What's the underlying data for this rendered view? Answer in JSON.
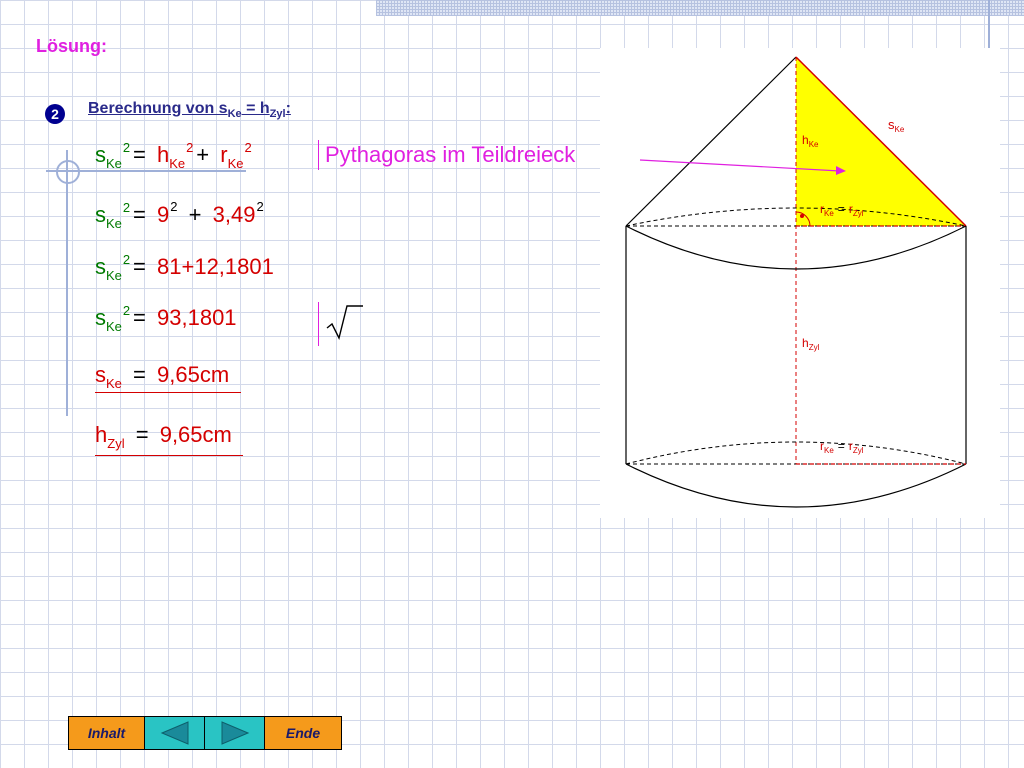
{
  "title": "Lösung:",
  "step": {
    "badge": "2",
    "heading_main": "Berechnung von s",
    "heading_sub1": "Ke",
    "heading_mid": " = h",
    "heading_sub2": "Zyl",
    "heading_end": ":"
  },
  "equations": [
    {
      "lhs": "s",
      "lhs_sub": "Ke",
      "lhs_sup": "2",
      "rhs": [
        "h",
        "Ke",
        "2",
        "+",
        "r",
        "Ke",
        "2"
      ]
    },
    {
      "lhs": "s",
      "lhs_sub": "Ke",
      "lhs_sup": "2",
      "rhs": [
        "9",
        "2",
        "+",
        "3,49",
        "2"
      ]
    },
    {
      "lhs": "s",
      "lhs_sub": "Ke",
      "lhs_sup": "2",
      "rhs": "81+12,1801"
    },
    {
      "lhs": "s",
      "lhs_sub": "Ke",
      "lhs_sup": "2",
      "rhs": "93,1801"
    },
    {
      "lhs": "s",
      "lhs_sub": "Ke",
      "rhs": "9,65cm"
    },
    {
      "lhs": "h",
      "lhs_sub": "Zyl",
      "rhs": "9,65cm"
    }
  ],
  "eq_sign": "=",
  "notes": {
    "pythagoras": "Pythagoras im Teildreieck",
    "root_symbol": "√"
  },
  "diagram_labels": {
    "s": "s",
    "s_sub": "Ke",
    "h_cone": "h",
    "h_cone_sub": "Ke",
    "r_top": "r",
    "r_top_sub": "Ke",
    "r_top_eq": "=",
    "r_top_r2": "r",
    "r_top_r2_sub": "Zyl",
    "h_cyl": "h",
    "h_cyl_sub": "Zyl",
    "r_bot": "r",
    "r_bot_sub": "Ke",
    "r_bot_eq": "=",
    "r_bot_r2": "r",
    "r_bot_r2_sub": "Zyl"
  },
  "nav": {
    "inhalt": "Inhalt",
    "ende": "Ende",
    "prev_icon": "left-arrow-icon",
    "next_icon": "right-arrow-icon"
  },
  "colors": {
    "title": "#e020e0",
    "formula_green": "#007a00",
    "formula_red": "#d40000",
    "triangle_fill": "#ffff00",
    "nav_orange": "#f59a1b",
    "nav_teal": "#29c4c4"
  }
}
